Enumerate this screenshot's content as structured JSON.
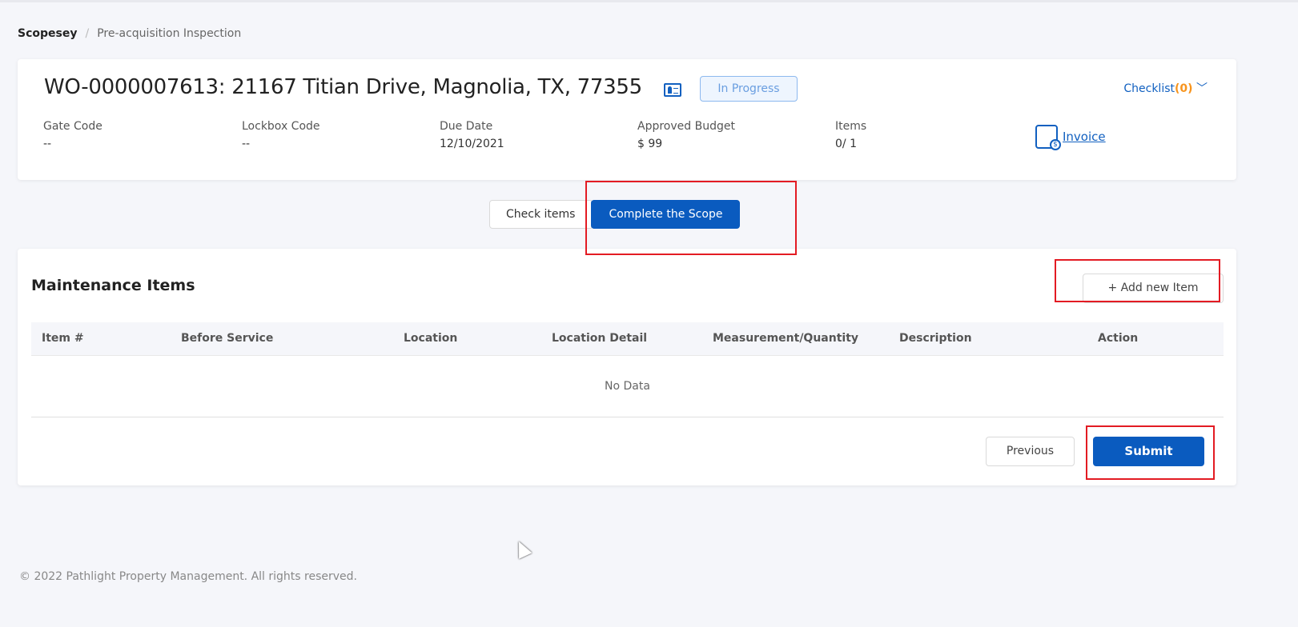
{
  "breadcrumb": {
    "root": "Scopesey",
    "separator": "/",
    "current": "Pre-acquisition Inspection"
  },
  "header": {
    "title": "WO-0000007613: 21167 Titian Drive, Magnolia, TX, 77355",
    "status": "In Progress",
    "checklist_label": "Checklist",
    "checklist_count": "(0)",
    "fields": [
      {
        "label": "Gate Code",
        "value": "--"
      },
      {
        "label": "Lockbox Code",
        "value": "--"
      },
      {
        "label": "Due Date",
        "value": "12/10/2021"
      },
      {
        "label": "Approved Budget",
        "value": "$ 99"
      },
      {
        "label": "Items",
        "value": "0/ 1"
      }
    ],
    "invoice_label": " Invoice"
  },
  "tabs": [
    {
      "label": "Check items"
    },
    {
      "label": "Complete the Scope",
      "active": true
    }
  ],
  "maintenance": {
    "title": "Maintenance Items",
    "add_label": "+ Add new Item",
    "columns": [
      "Item #",
      "Before Service",
      "Location",
      "Location Detail",
      "Measurement/Quantity",
      "Description",
      "Action"
    ],
    "empty": "No Data",
    "previous_label": "Previous",
    "submit_label": "Submit"
  },
  "footer": "© 2022 Pathlight Property Management. All rights reserved.",
  "colors": {
    "primary": "#0a5bbf",
    "accent": "#f7941d",
    "annotation": "#e31b23"
  }
}
